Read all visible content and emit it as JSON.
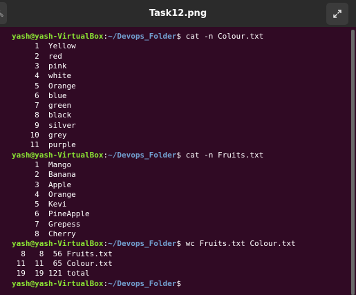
{
  "window": {
    "title": "Task12.png"
  },
  "prompt": {
    "user_host": "yash@yash-VirtualBox",
    "path": "~/Devops_Folder"
  },
  "lines": [
    {
      "type": "prompt",
      "command": "cat -n Colour.txt"
    },
    {
      "type": "out",
      "text": "     1\tYellow"
    },
    {
      "type": "out",
      "text": "     2\tred"
    },
    {
      "type": "out",
      "text": "     3\tpink"
    },
    {
      "type": "out",
      "text": "     4\twhite"
    },
    {
      "type": "out",
      "text": "     5\tOrange"
    },
    {
      "type": "out",
      "text": "     6\tblue"
    },
    {
      "type": "out",
      "text": "     7\tgreen"
    },
    {
      "type": "out",
      "text": "     8\tblack"
    },
    {
      "type": "out",
      "text": "     9\tsilver"
    },
    {
      "type": "out",
      "text": "    10\tgrey"
    },
    {
      "type": "out",
      "text": "    11\tpurple"
    },
    {
      "type": "prompt",
      "command": "cat -n Fruits.txt"
    },
    {
      "type": "out",
      "text": "     1\tMango"
    },
    {
      "type": "out",
      "text": "     2\tBanana"
    },
    {
      "type": "out",
      "text": "     3\tApple"
    },
    {
      "type": "out",
      "text": "     4\tOrange"
    },
    {
      "type": "out",
      "text": "     5\tKevi"
    },
    {
      "type": "out",
      "text": "     6\tPineApple"
    },
    {
      "type": "out",
      "text": "     7\tGrepess"
    },
    {
      "type": "out",
      "text": "     8\tCherry"
    },
    {
      "type": "prompt",
      "command": "wc Fruits.txt Colour.txt"
    },
    {
      "type": "out",
      "text": "  8   8  56 Fruits.txt"
    },
    {
      "type": "out",
      "text": " 11  11  65 Colour.txt"
    },
    {
      "type": "out",
      "text": " 19  19 121 total"
    },
    {
      "type": "prompt",
      "command": ""
    }
  ],
  "icons": {
    "search": "search-icon",
    "expand": "expand-icon"
  },
  "colors": {
    "background": "#300a24",
    "user": "#8ae234",
    "path": "#729fcf",
    "titlebar": "#2b2b2b"
  }
}
